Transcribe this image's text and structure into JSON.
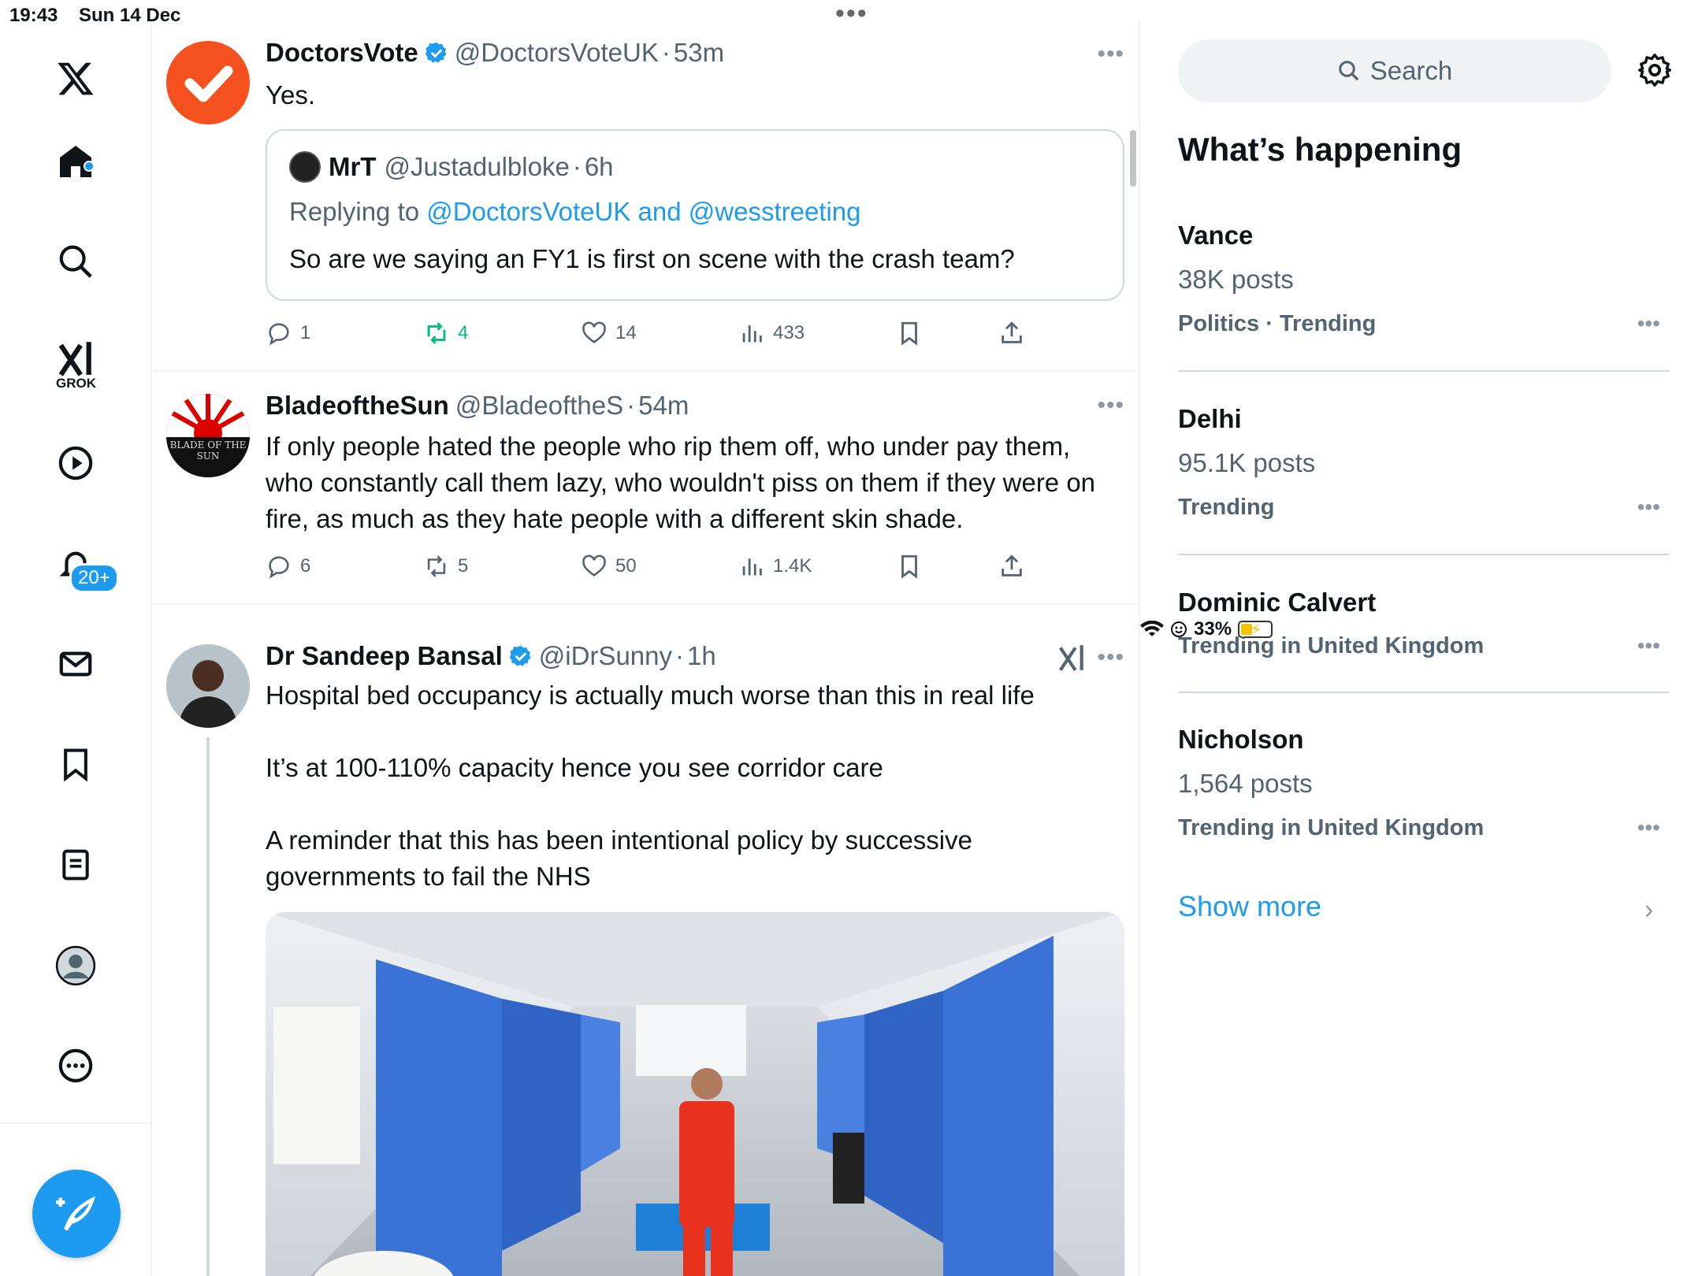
{
  "status_bar": {
    "time": "19:43",
    "date": "Sun 14 Dec",
    "battery": "33%",
    "multitask": "•••"
  },
  "nav": {
    "grok_label": "GROK",
    "notifications_badge": "20+"
  },
  "tweets": [
    {
      "name": "DoctorsVote",
      "handle": "@DoctorsVoteUK",
      "time": "53m",
      "text": "Yes.",
      "quote": {
        "name": "MrT",
        "handle": "@Justadulbloke",
        "time": "6h",
        "replying_prefix": "Replying to ",
        "replying_to": "@DoctorsVoteUK and @wesstreeting",
        "text": "So are we saying an FY1 is first on scene with the crash team?"
      },
      "replies": "1",
      "reposts": "4",
      "likes": "14",
      "views": "433"
    },
    {
      "name": "BladeoftheSun",
      "handle": "@BladeoftheS",
      "time": "54m",
      "text": "If only people hated the people who rip them off, who under pay them, who constantly call them lazy, who wouldn't piss on them if they were on fire, as much as they hate people with a different skin shade.",
      "avatar_text": "BLADE OF THE SUN",
      "replies": "6",
      "reposts": "5",
      "likes": "50",
      "views": "1.4K"
    },
    {
      "name": "Dr Sandeep Bansal",
      "handle": "@iDrSunny",
      "time": "1h",
      "text": "Hospital bed occupancy is actually much worse than this in real life\n\nIt’s at 100-110% capacity hence you see corridor care\n\nA reminder that this has been intentional policy by successive governments to fail the NHS"
    }
  ],
  "sidebar": {
    "search_placeholder": "Search",
    "title": "What’s happening",
    "trends": [
      {
        "topic": "Vance",
        "posts": "38K posts",
        "category": "Politics · Trending"
      },
      {
        "topic": "Delhi",
        "posts": "95.1K posts",
        "category": "Trending"
      },
      {
        "topic": "Dominic Calvert",
        "posts": "",
        "category": "Trending in United Kingdom"
      },
      {
        "topic": "Nicholson",
        "posts": "1,564 posts",
        "category": "Trending in United Kingdom"
      }
    ],
    "show_more": "Show more"
  },
  "colors": {
    "accent": "#1d9bf0",
    "repost_active": "#00ba7c",
    "text_secondary": "#536471"
  }
}
